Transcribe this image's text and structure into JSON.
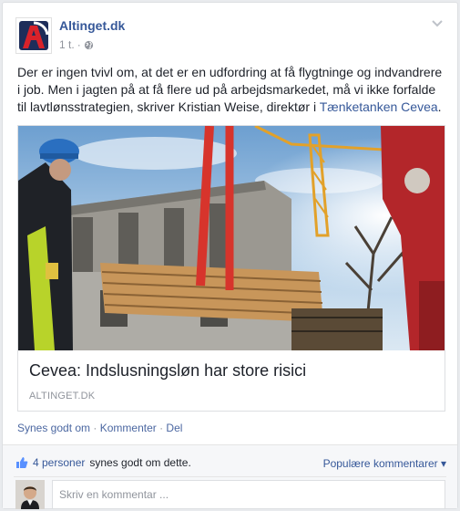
{
  "post": {
    "page_name": "Altinget.dk",
    "time": "1 t.",
    "separator": "·",
    "text_main": "Der er ingen tvivl om, at det er en udfordring at få flygtninge og indvandrere i job. Men i jagten på at få flere ud på arbejdsmarkedet, må vi ikke forfalde til lavtlønsstrategien, skriver Kristian Weise, direktør i ",
    "text_link": "Tænketanken Cevea",
    "text_end": ".",
    "link_title": "Cevea: Indslusningsløn har store risici",
    "link_domain": "ALTINGET.DK"
  },
  "actions": {
    "like": "Synes godt om",
    "sep": " · ",
    "comment": "Kommenter",
    "share": "Del"
  },
  "ufi": {
    "likes_count": "4 personer",
    "likes_text": "synes godt om dette.",
    "popular_comments": "Populære kommentarer ▾",
    "comment_placeholder": "Skriv en kommentar ..."
  },
  "colors": {
    "link": "#365899",
    "meta": "#90949c",
    "logo_red": "#d9222a",
    "logo_navy": "#1e2d5a"
  },
  "icons": [
    "altinget-logo",
    "globe-icon",
    "chevron-down-icon",
    "thumbs-up-icon",
    "user-avatar"
  ]
}
